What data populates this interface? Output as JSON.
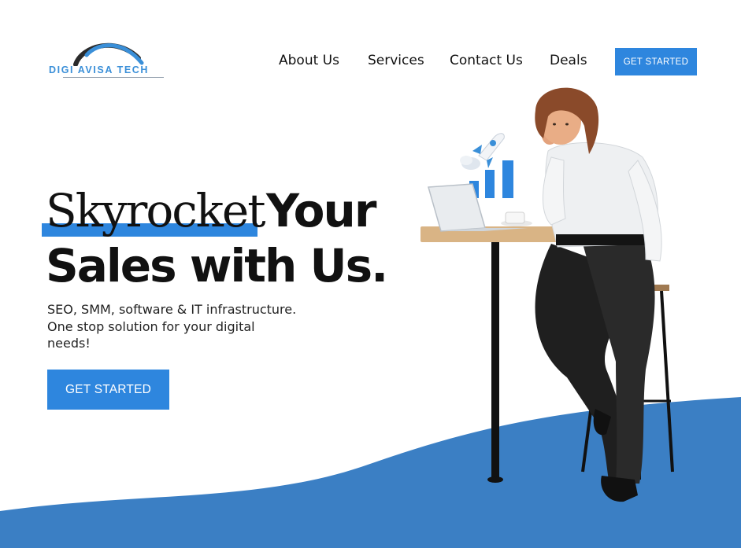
{
  "brand": {
    "name": "DIGI AVISA TECH",
    "accent": "#2e86de",
    "dark_arc": "#2b2b2b"
  },
  "nav": {
    "items": [
      "About Us",
      "Services",
      "Contact Us",
      "Deals"
    ],
    "cta_label": "GET STARTED"
  },
  "hero": {
    "title_word_1": "Skyrocket",
    "title_word_2": "Your",
    "title_line_2": "Sales with Us.",
    "subtitle_lines": [
      "SEO, SMM, software & IT infrastructure.",
      "One stop solution for your digital",
      "needs!"
    ],
    "cta_label": "GET STARTED"
  },
  "colors": {
    "wave": "#3b7fc4",
    "button": "#2e86de"
  },
  "icons": {
    "logo": "arc-logo-icon",
    "illustration": "woman-at-desk-illustration",
    "rocket": "rocket-icon",
    "bar_chart": "bar-chart-icon"
  }
}
